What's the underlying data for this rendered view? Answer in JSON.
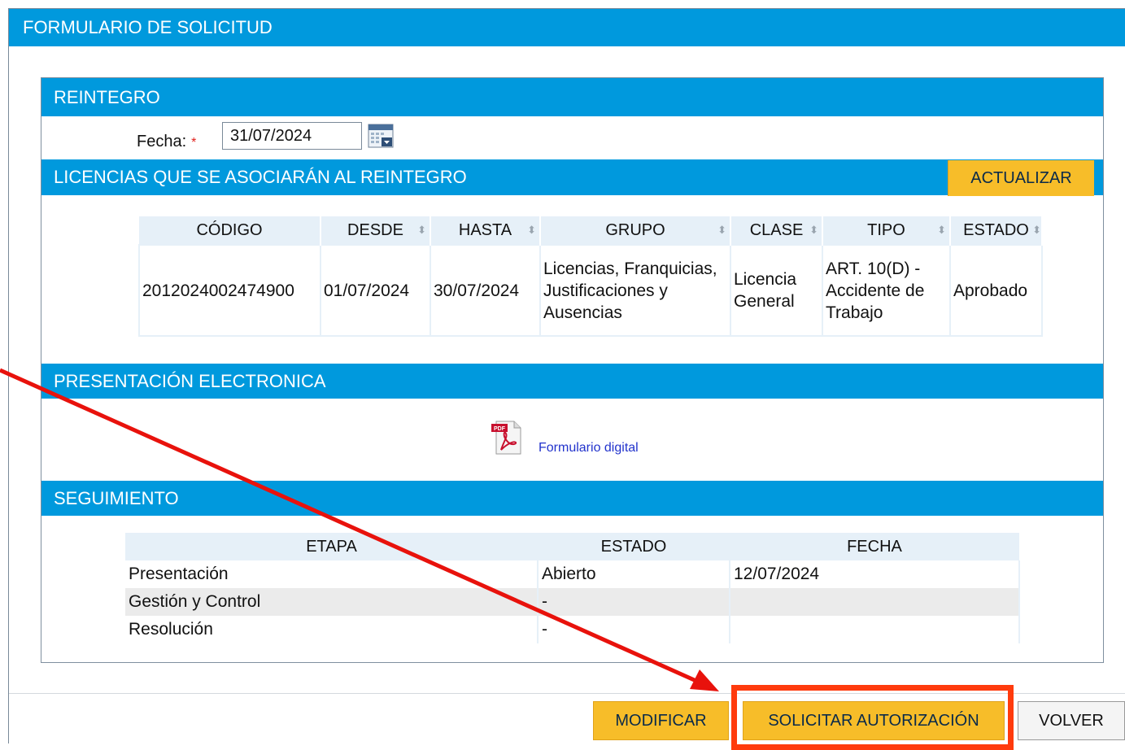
{
  "header": {
    "title": "FORMULARIO DE SOLICITUD"
  },
  "reintegro": {
    "title": "REINTEGRO",
    "fecha_label": "Fecha:",
    "required_mark": "*",
    "fecha_value": "31/07/2024"
  },
  "licencias": {
    "title": "LICENCIAS QUE SE ASOCIARÁN AL REINTEGRO",
    "actualizar_label": "ACTUALIZAR",
    "columns": [
      "CÓDIGO",
      "DESDE",
      "HASTA",
      "GRUPO",
      "CLASE",
      "TIPO",
      "ESTADO"
    ],
    "rows": [
      {
        "codigo": "2012024002474900",
        "desde": "01/07/2024",
        "hasta": "30/07/2024",
        "grupo": "Licencias, Franquicias, Justificaciones y Ausencias",
        "clase": "Licencia General",
        "tipo": "ART. 10(D) - Accidente de Trabajo",
        "estado": "Aprobado"
      }
    ]
  },
  "presentacion": {
    "title": "PRESENTACIÓN ELECTRONICA",
    "link_label": "Formulario digital",
    "icon": "pdf-icon"
  },
  "seguimiento": {
    "title": "SEGUIMIENTO",
    "columns": [
      "ETAPA",
      "ESTADO",
      "FECHA"
    ],
    "rows": [
      {
        "etapa": "Presentación",
        "estado": "Abierto",
        "fecha": "12/07/2024"
      },
      {
        "etapa": "Gestión y Control",
        "estado": "-",
        "fecha": ""
      },
      {
        "etapa": "Resolución",
        "estado": "-",
        "fecha": ""
      }
    ]
  },
  "footer": {
    "modificar_label": "MODIFICAR",
    "solicitar_label": "SOLICITAR AUTORIZACIÓN",
    "volver_label": "VOLVER"
  },
  "colors": {
    "header_blue": "#0099dd",
    "button_yellow": "#f7bd29",
    "annotation_red": "#e8120c",
    "annotation_orange": "#ff3b0d"
  }
}
